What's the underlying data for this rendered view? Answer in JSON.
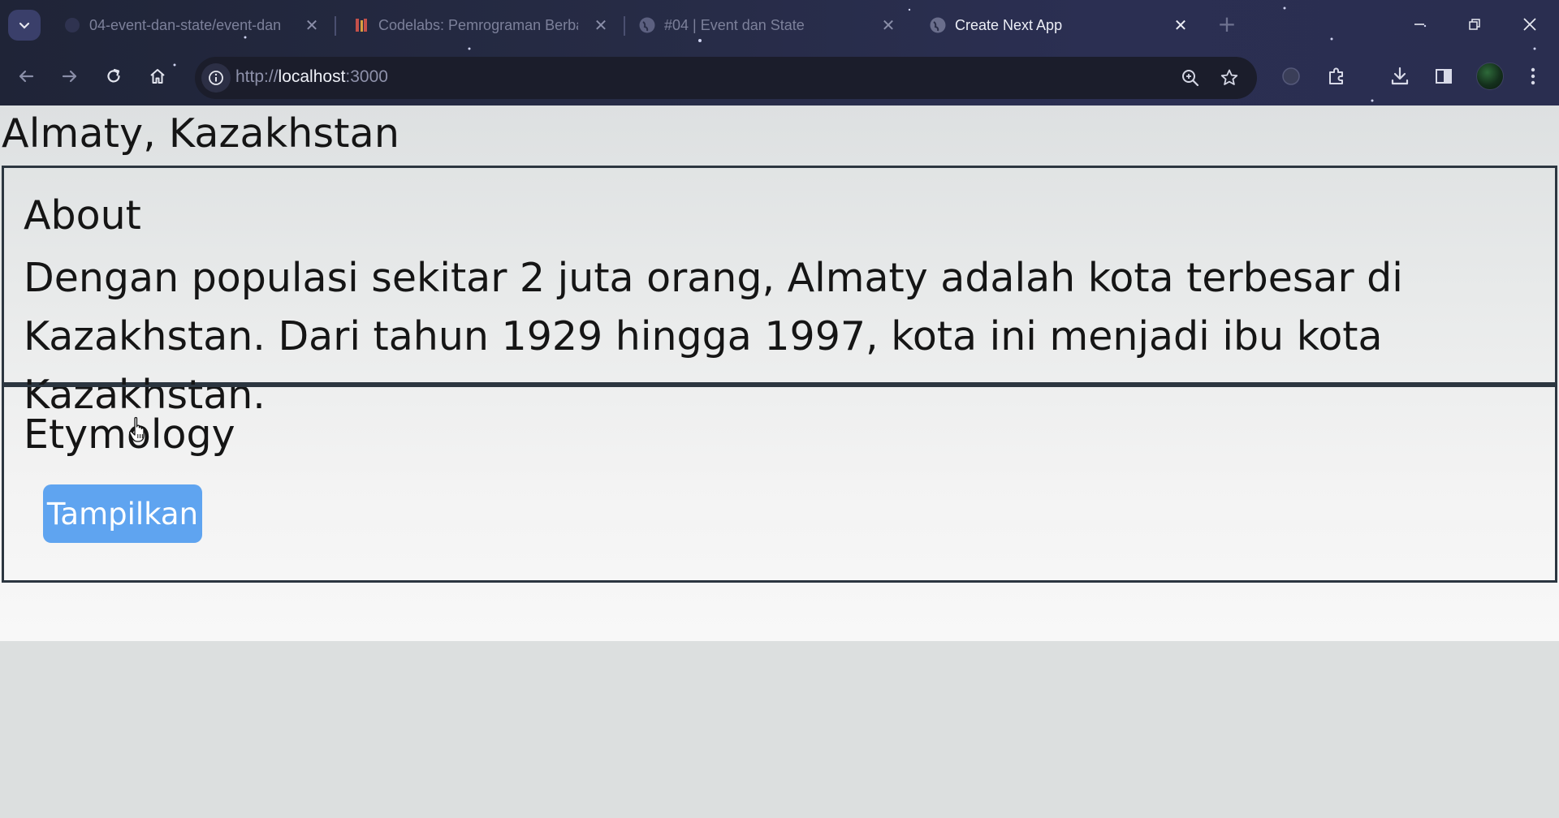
{
  "browser": {
    "tabs": [
      {
        "title": "04-event-dan-state/event-dan",
        "active": false
      },
      {
        "title": "Codelabs: Pemrograman Berba",
        "active": false
      },
      {
        "title": "#04 | Event dan State",
        "active": false
      },
      {
        "title": "Create Next App",
        "active": true
      }
    ],
    "url": {
      "scheme": "http://",
      "host": "localhost",
      "port": ":3000"
    }
  },
  "page": {
    "title": "Almaty, Kazakhstan",
    "about": {
      "heading": "About",
      "text": "Dengan populasi sekitar 2 juta orang, Almaty adalah kota terbesar di Kazakhstan. Dari tahun 1929 hingga 1997, kota ini menjadi ibu kota Kazakhstan."
    },
    "etymology": {
      "heading": "Etymology",
      "button_label": "Tampilkan"
    }
  },
  "colors": {
    "button_bg": "#5fa4f0",
    "section_border": "#2c3640",
    "chrome_bg": "#262b45"
  }
}
